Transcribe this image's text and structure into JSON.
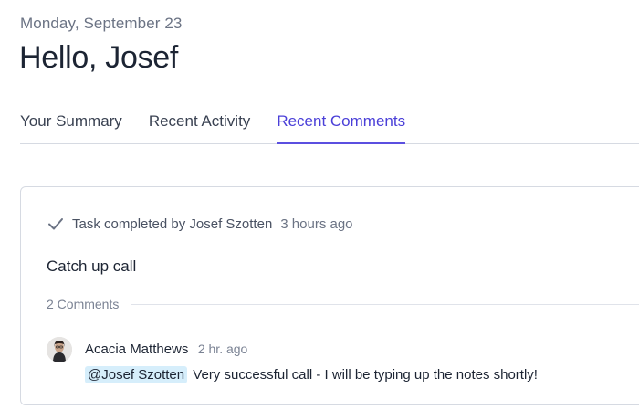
{
  "header": {
    "date": "Monday, September 23",
    "greeting": "Hello, Josef"
  },
  "tabs": [
    {
      "label": "Your Summary",
      "active": false
    },
    {
      "label": "Recent Activity",
      "active": false
    },
    {
      "label": "Recent Comments",
      "active": true
    }
  ],
  "card": {
    "task_prefix": "Task completed by Josef Szotten",
    "task_time": "3 hours ago",
    "task_title": "Catch up call",
    "comments_count": "2 Comments",
    "comment": {
      "author": "Acacia Matthews",
      "time": "2 hr. ago",
      "mention": "@Josef Szotten",
      "text": "Very successful call - I will be typing up the notes shortly!"
    }
  },
  "icons": {
    "check": "check-icon",
    "avatar": "avatar"
  },
  "colors": {
    "accent": "#5b4fe0",
    "mention_bg": "#d6eefb",
    "muted": "#6b7384"
  }
}
